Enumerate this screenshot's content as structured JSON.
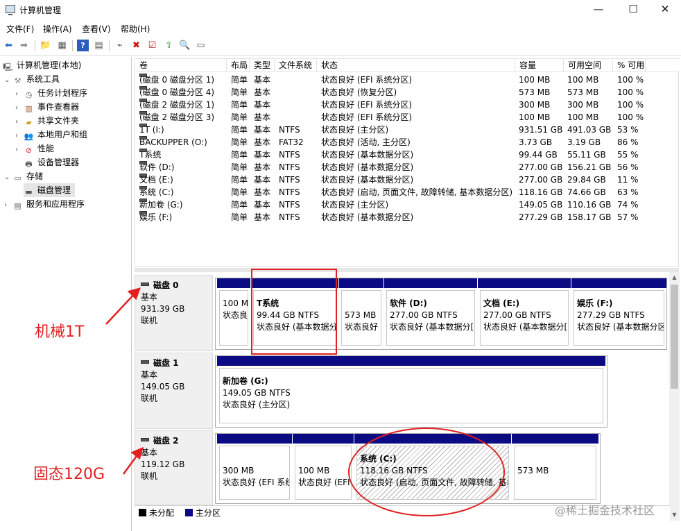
{
  "window": {
    "title": "计算机管理",
    "min": "—",
    "max": "☐",
    "close": "✕"
  },
  "menu": [
    "文件(F)",
    "操作(A)",
    "查看(V)",
    "帮助(H)"
  ],
  "tree": {
    "root": "计算机管理(本地)",
    "system_tools": "系统工具",
    "task_scheduler": "任务计划程序",
    "event_viewer": "事件查看器",
    "shared_folders": "共享文件夹",
    "local_users": "本地用户和组",
    "performance": "性能",
    "device_manager": "设备管理器",
    "storage": "存储",
    "disk_management": "磁盘管理",
    "services_apps": "服务和应用程序"
  },
  "volume_headers": [
    "卷",
    "布局",
    "类型",
    "文件系统",
    "状态",
    "容量",
    "可用空间",
    "% 可用"
  ],
  "volumes": [
    [
      "(磁盘 0 磁盘分区 1)",
      "简单",
      "基本",
      "",
      "状态良好 (EFI 系统分区)",
      "100 MB",
      "100 MB",
      "100 %"
    ],
    [
      "(磁盘 0 磁盘分区 4)",
      "简单",
      "基本",
      "",
      "状态良好 (恢复分区)",
      "573 MB",
      "573 MB",
      "100 %"
    ],
    [
      "(磁盘 2 磁盘分区 1)",
      "简单",
      "基本",
      "",
      "状态良好 (EFI 系统分区)",
      "300 MB",
      "300 MB",
      "100 %"
    ],
    [
      "(磁盘 2 磁盘分区 3)",
      "简单",
      "基本",
      "",
      "状态良好 (EFI 系统分区)",
      "100 MB",
      "100 MB",
      "100 %"
    ],
    [
      "1T (I:)",
      "简单",
      "基本",
      "NTFS",
      "状态良好 (主分区)",
      "931.51 GB",
      "491.03 GB",
      "53 %"
    ],
    [
      "BACKUPPER (O:)",
      "简单",
      "基本",
      "FAT32",
      "状态良好 (活动, 主分区)",
      "3.73 GB",
      "3.19 GB",
      "86 %"
    ],
    [
      "T系统",
      "简单",
      "基本",
      "NTFS",
      "状态良好 (基本数据分区)",
      "99.44 GB",
      "55.11 GB",
      "55 %"
    ],
    [
      "软件 (D:)",
      "简单",
      "基本",
      "NTFS",
      "状态良好 (基本数据分区)",
      "277.00 GB",
      "156.21 GB",
      "56 %"
    ],
    [
      "文档 (E:)",
      "简单",
      "基本",
      "NTFS",
      "状态良好 (基本数据分区)",
      "277.00 GB",
      "29.84 GB",
      "11 %"
    ],
    [
      "系统 (C:)",
      "简单",
      "基本",
      "NTFS",
      "状态良好 (启动, 页面文件, 故障转储, 基本数据分区)",
      "118.16 GB",
      "74.66 GB",
      "63 %"
    ],
    [
      "新加卷 (G:)",
      "简单",
      "基本",
      "NTFS",
      "状态良好 (主分区)",
      "149.05 GB",
      "110.16 GB",
      "74 %"
    ],
    [
      "娱乐 (F:)",
      "简单",
      "基本",
      "NTFS",
      "状态良好 (基本数据分区)",
      "277.29 GB",
      "158.17 GB",
      "57 %"
    ]
  ],
  "disks": [
    {
      "name": "磁盘 0",
      "type": "基本",
      "size": "931.39 GB",
      "state": "联机",
      "parts": [
        {
          "title": "",
          "size": "100 M",
          "status": "状态良"
        },
        {
          "title": "T系统",
          "size": "99.44 GB NTFS",
          "status": "状态良好 (基本数据分"
        },
        {
          "title": "",
          "size": "573 MB",
          "status": "状态良好"
        },
        {
          "title": "软件   (D:)",
          "size": "277.00 GB NTFS",
          "status": "状态良好 (基本数据分["
        },
        {
          "title": "文档   (E:)",
          "size": "277.00 GB NTFS",
          "status": "状态良好 (基本数据分["
        },
        {
          "title": "娱乐   (F:)",
          "size": "277.29 GB NTFS",
          "status": "状态良好 (基本数据分区"
        }
      ]
    },
    {
      "name": "磁盘 1",
      "type": "基本",
      "size": "149.05 GB",
      "state": "联机",
      "parts": [
        {
          "title": "新加卷   (G:)",
          "size": "149.05 GB NTFS",
          "status": "状态良好 (主分区)"
        }
      ]
    },
    {
      "name": "磁盘 2",
      "type": "基本",
      "size": "119.12 GB",
      "state": "联机",
      "parts": [
        {
          "title": "",
          "size": "300 MB",
          "status": "状态良好 (EFI 系统"
        },
        {
          "title": "",
          "size": "100 MB",
          "status": "状态良好 (EFI"
        },
        {
          "title": "系统   (C:)",
          "size": "118.16 GB NTFS",
          "status": "状态良好 (启动, 页面文件, 故障转储, 基本"
        },
        {
          "title": "",
          "size": "573 MB",
          "status": ""
        }
      ]
    }
  ],
  "legend": {
    "unallocated": "未分配",
    "primary": "主分区",
    "unallocated_color": "#000000",
    "primary_color": "#0b0b83"
  },
  "annotations": {
    "hdd": "机械1T",
    "ssd": "固态120G",
    "color": "#e02020"
  },
  "watermark": "@稀土掘金技术社区"
}
